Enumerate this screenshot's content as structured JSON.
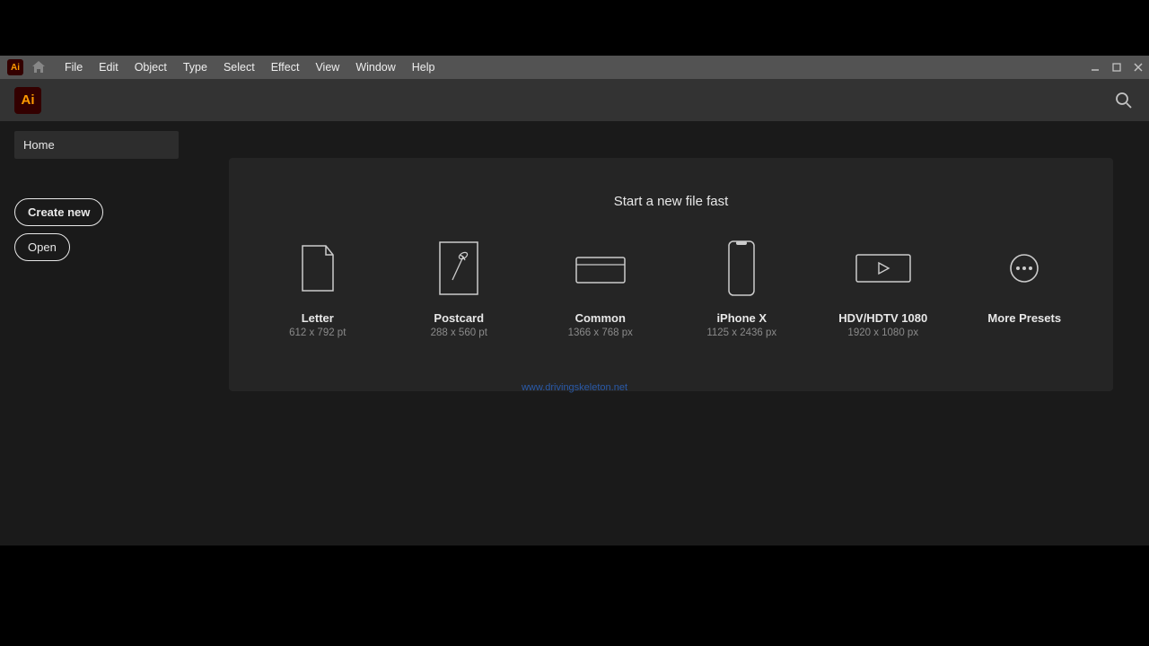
{
  "menubar": {
    "items": [
      "File",
      "Edit",
      "Object",
      "Type",
      "Select",
      "Effect",
      "View",
      "Window",
      "Help"
    ]
  },
  "sidebar": {
    "home": "Home",
    "create_new": "Create new",
    "open": "Open"
  },
  "main": {
    "title": "Start a new file fast",
    "presets": [
      {
        "name": "Letter",
        "dims": "612 x 792 pt",
        "icon": "letter"
      },
      {
        "name": "Postcard",
        "dims": "288 x 560 pt",
        "icon": "postcard"
      },
      {
        "name": "Common",
        "dims": "1366 x 768 px",
        "icon": "web"
      },
      {
        "name": "iPhone X",
        "dims": "1125 x 2436 px",
        "icon": "phone"
      },
      {
        "name": "HDV/HDTV 1080",
        "dims": "1920 x 1080 px",
        "icon": "video"
      },
      {
        "name": "More Presets",
        "dims": "",
        "icon": "more"
      }
    ]
  },
  "watermark": "www.drivingskeleton.net"
}
